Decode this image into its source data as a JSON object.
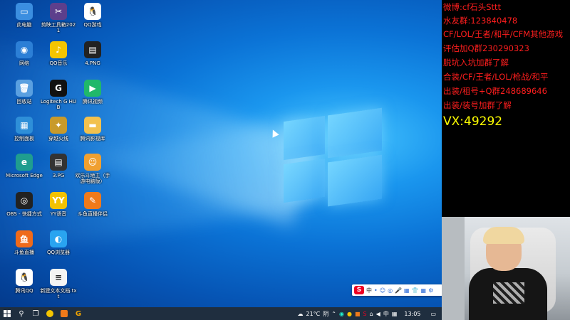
{
  "desktop": {
    "icons": [
      {
        "label": "此电脑",
        "icon": "computer-icon",
        "color": "#3b8ee0",
        "glyph": "▭"
      },
      {
        "label": "剪映工具箱2021",
        "icon": "toolbox-icon",
        "color": "#5d3f8c",
        "glyph": "✂"
      },
      {
        "label": "QQ游戏",
        "icon": "qq-game-icon",
        "color": "#ffffff",
        "glyph": "🐧"
      },
      {
        "label": "网络",
        "icon": "network-icon",
        "color": "#2c7fd6",
        "glyph": "◉"
      },
      {
        "label": "QQ音乐",
        "icon": "qq-music-icon",
        "color": "#f5c500",
        "glyph": "♪"
      },
      {
        "label": "4.PNG",
        "icon": "image-file-icon",
        "color": "#222222",
        "glyph": "▤"
      },
      {
        "label": "回收站",
        "icon": "recycle-bin-icon",
        "color": "#5aa0e0",
        "glyph": "🗑"
      },
      {
        "label": "Logitech G HUB",
        "icon": "logitech-icon",
        "color": "#111111",
        "glyph": "G"
      },
      {
        "label": "腾讯视频",
        "icon": "tencent-video-icon",
        "color": "#20b86a",
        "glyph": "▶"
      },
      {
        "label": "控制面板",
        "icon": "control-panel-icon",
        "color": "#2e8fd8",
        "glyph": "▦"
      },
      {
        "label": "穿越火线",
        "icon": "crossfire-icon",
        "color": "#c89a2a",
        "glyph": "✦"
      },
      {
        "label": "腾讯影视库",
        "icon": "folder-icon",
        "color": "#f2c14e",
        "glyph": "▬"
      },
      {
        "label": "Microsoft Edge",
        "icon": "edge-icon",
        "color": "#1f9d8f",
        "glyph": "e"
      },
      {
        "label": "3.PG",
        "icon": "image-file-icon",
        "color": "#333333",
        "glyph": "▤"
      },
      {
        "label": "欢乐斗地主（手游电脑版）",
        "icon": "doudizhu-icon",
        "color": "#f0a030",
        "glyph": "☺"
      },
      {
        "label": "OBS - 快捷方式",
        "icon": "obs-icon",
        "color": "#222222",
        "glyph": "◎"
      },
      {
        "label": "YY语音",
        "icon": "yy-icon",
        "color": "#f2c200",
        "glyph": "YY"
      },
      {
        "label": "斗鱼直播伴侣",
        "icon": "douyu-companion-icon",
        "color": "#f07a1a",
        "glyph": "✎"
      },
      {
        "label": "斗鱼直播",
        "icon": "douyu-icon",
        "color": "#ef6a1a",
        "glyph": "鱼"
      },
      {
        "label": "QQ浏览器",
        "icon": "qq-browser-icon",
        "color": "#29a4f0",
        "glyph": "◐"
      },
      {
        "label": "腾讯QQ",
        "icon": "qq-icon",
        "color": "#ffffff",
        "glyph": "🐧"
      },
      {
        "label": "新建文本文档.txt",
        "icon": "text-file-icon",
        "color": "#f4f4f4",
        "glyph": "≡"
      }
    ]
  },
  "ime": {
    "logo": "S",
    "mode": "中",
    "items": [
      "•",
      "☺",
      "◎",
      "🎤",
      "▦",
      "👕",
      "▦",
      "⚙"
    ]
  },
  "taskbar": {
    "start_icon": "windows-icon",
    "weather": "21°C",
    "weather_word": "阴",
    "ime_mode": "中",
    "time": "13:05"
  },
  "panel": {
    "lines": [
      "微博:cf石头Sttt",
      "水友群:123840478",
      "CF/LOL/王者/和平/CFM其他游戏",
      "评估加Q群230290323",
      "脱坑入坑加群了解",
      "合装/CF/王者/LOL/枪战/和平",
      "出装/租号+Q群248689646",
      "出装/装号加群了解"
    ],
    "highlight": "VX:49292"
  }
}
